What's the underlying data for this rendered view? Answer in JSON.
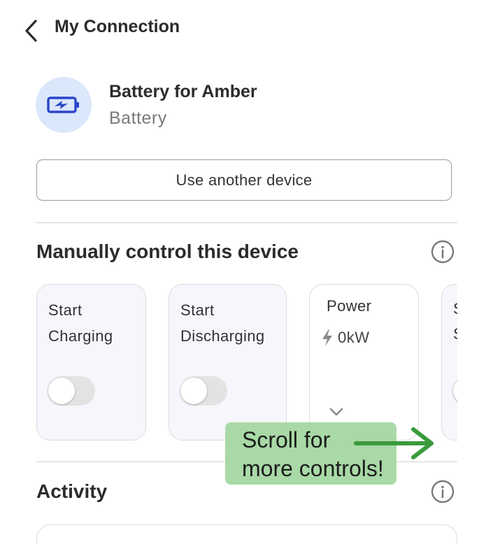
{
  "header": {
    "title": "My Connection"
  },
  "device": {
    "name": "Battery for Amber",
    "type": "Battery",
    "icon": "battery-charging-icon",
    "accent_color": "#2a46c9",
    "avatar_bg": "#dbe7fb"
  },
  "actions": {
    "use_another_device": "Use another device"
  },
  "manual_control": {
    "title": "Manually control this device",
    "cards": [
      {
        "line1": "Start",
        "line2": "Charging",
        "toggle_on": false
      },
      {
        "line1": "Start",
        "line2": "Discharging",
        "toggle_on": false
      },
      {
        "label": "Power",
        "value": "0kW"
      }
    ]
  },
  "callout": {
    "line1": "Scroll for",
    "line2": "more controls!",
    "color": "#a8d9a6",
    "arrow_color": "#3a9a3c"
  },
  "activity": {
    "title": "Activity"
  }
}
